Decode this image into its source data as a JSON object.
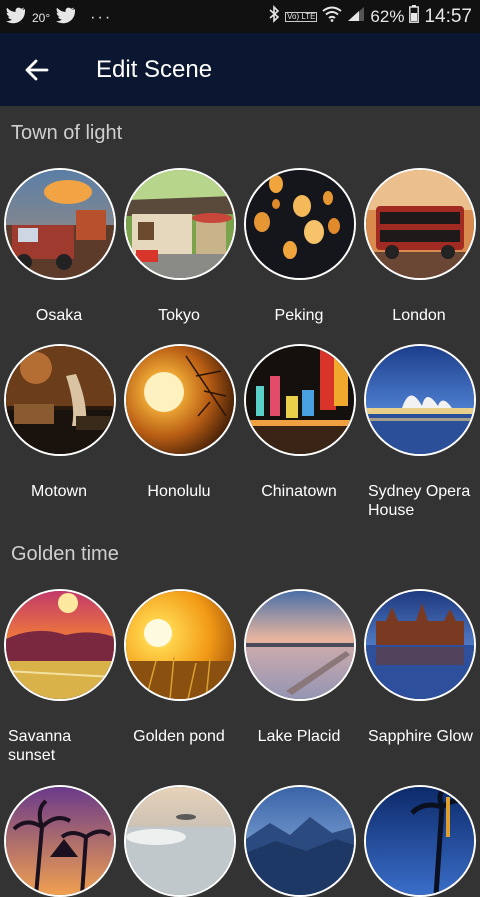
{
  "status_bar": {
    "temperature": "20°",
    "more": "···",
    "lte": "Vo) LTE",
    "battery": "62%",
    "time": "14:57"
  },
  "app_bar": {
    "title": "Edit Scene"
  },
  "sections": [
    {
      "title": "Town of light",
      "items": [
        {
          "label": "Osaka"
        },
        {
          "label": "Tokyo"
        },
        {
          "label": "Peking"
        },
        {
          "label": "London"
        },
        {
          "label": "Motown"
        },
        {
          "label": "Honolulu"
        },
        {
          "label": "Chinatown"
        },
        {
          "label": "Sydney Opera House"
        }
      ]
    },
    {
      "title": "Golden time",
      "items": [
        {
          "label": "Savanna sunset"
        },
        {
          "label": "Golden pond"
        },
        {
          "label": "Lake Placid"
        },
        {
          "label": "Sapphire Glow"
        }
      ]
    }
  ]
}
